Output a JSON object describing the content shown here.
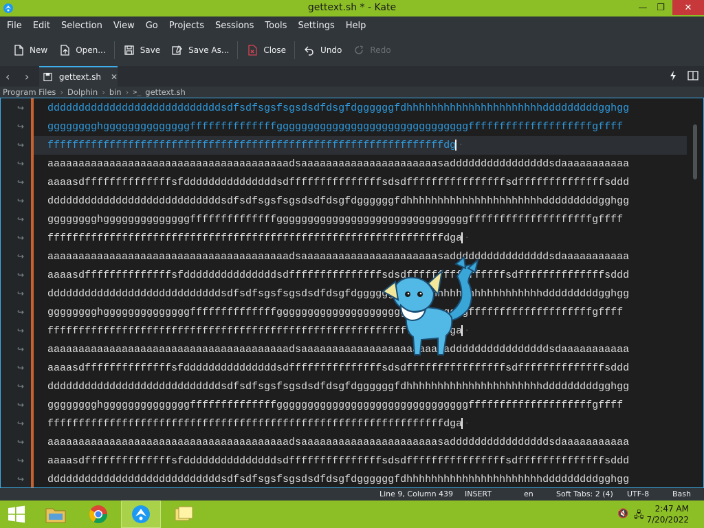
{
  "window": {
    "title": "gettext.sh * - Kate",
    "controls": {
      "minimize": "—",
      "restore": "❐",
      "close": "✕"
    }
  },
  "menu": [
    "File",
    "Edit",
    "Selection",
    "View",
    "Go",
    "Projects",
    "Sessions",
    "Tools",
    "Settings",
    "Help"
  ],
  "toolbar": {
    "new": "New",
    "open": "Open...",
    "save": "Save",
    "save_as": "Save As...",
    "close": "Close",
    "undo": "Undo",
    "redo": "Redo"
  },
  "tabs": [
    {
      "label": "gettext.sh",
      "close": "✕"
    }
  ],
  "breadcrumb": [
    "Program Files",
    "Dolphin",
    "bin",
    "gettext.sh"
  ],
  "breadcrumb_term_glyph": ">_",
  "editor": {
    "wrap_marker": "↪",
    "lines": [
      "ddddddddddddddddddddddddddddsdfsdfsgsfsgsdsdfdsgfdggggggfdhhhhhhhhhhhhhhhhhhhhhhdddddddddgghgg",
      "gggggggghggggggggggggggffffffffffffffgggggggggggggggggggggggggggggggffffffffffffffffffffgffff",
      "ffffffffffffffffffffffffffffffffffffffffffffffffffffffffffffffffdg",
      "aaaaaaaaaaaaaaaaaaaaaaaaaaaaaaaaaaaaaaadsaaaaaaaaaaaaaaaaaaaaaasaddddddddddddddddsdaaaaaaaaaaa",
      "aaaasdffffffffffffffsfdddddddddddddddsdfffffffffffffffsdsdffffffffffffffffsdffffffffffffffsddd",
      "ddddddddddddddddddddddddddddsdfsdfsgsfsgsdsdfdsgfdggggggfdhhhhhhhhhhhhhhhhhhhhhhdddddddddgghgg",
      "gggggggghggggggggggggggffffffffffffffgggggggggggggggggggggggggggggggffffffffffffffffffffgffff",
      "ffffffffffffffffffffffffffffffffffffffffffffffffffffffffffffffffdga",
      "aaaaaaaaaaaaaaaaaaaaaaaaaaaaaaaaaaaaaaadsaaaaaaaaaaaaaaaaaaaaaasaddddddddddddddddsdaaaaaaaaaaa",
      "aaaasdffffffffffffffsfdddddddddddddddsdfffffffffffffffsdsdffffffffffffffffsdffffffffffffffsddd",
      "ddddddddddddddddddddddddddddsdfsdfsgsfsgsdsdfdsgfdggggggfdhhhhhhhhhhhhhhhhhhhhhhdddddddddgghgg",
      "gggggggghggggggggggggggffffffffffffffgggggggggggggggggggggggggggggggffffffffffffffffffffgffff",
      "ffffffffffffffffffffffffffffffffffffffffffffffffffffffffffffffffdga",
      "aaaaaaaaaaaaaaaaaaaaaaaaaaaaaaaaaaaaaaadsaaaaaaaaaaaaaaaaaaaaaasaddddddddddddddddsdaaaaaaaaaaa",
      "aaaasdffffffffffffffsfdddddddddddddddsdfffffffffffffffsdsdffffffffffffffffsdffffffffffffffsddd",
      "ddddddddddddddddddddddddddddsdfsdfsgsfsgsdsdfdsgfdggggggfdhhhhhhhhhhhhhhhhhhhhhhdddddddddgghgg",
      "gggggggghggggggggggggggffffffffffffffgggggggggggggggggggggggggggggggffffffffffffffffffffgffff",
      "ffffffffffffffffffffffffffffffffffffffffffffffffffffffffffffffffdga",
      "aaaaaaaaaaaaaaaaaaaaaaaaaaaaaaaaaaaaaaadsaaaaaaaaaaaaaaaaaaaaaasaddddddddddddddddsdaaaaaaaaaaa",
      "aaaasdffffffffffffffsfdddddddddddddddsdfffffffffffffffsdsdffffffffffffffffsdffffffffffffffsddd",
      "ddddddddddddddddddddddddddddsdfsdfsgsfsgsdsdfdsgfdggggggfdhhhhhhhhhhhhhhhhhhhhhhdddddddddgghgg"
    ]
  },
  "status": {
    "position": "Line 9, Column 439",
    "mode": "INSERT",
    "language": "en",
    "indent": "Soft Tabs: 2 (4)",
    "encoding": "UTF-8",
    "syntax": "Bash"
  },
  "taskbar": {
    "time": "2:47 AM",
    "date": "7/20/2022"
  },
  "colors": {
    "accent": "#8cbf26",
    "selection_text": "#2f9ade",
    "modified_line": "#c9612f",
    "focus_border": "#3daee9"
  }
}
